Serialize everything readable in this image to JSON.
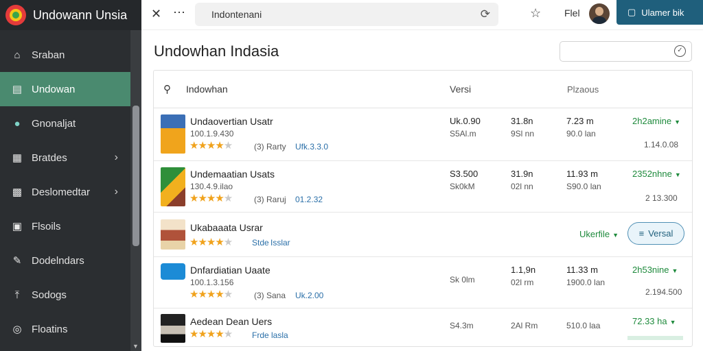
{
  "app": {
    "title": "Undowann Unsia"
  },
  "sidebar": {
    "items": [
      {
        "label": "Sraban",
        "icon": "home-icon"
      },
      {
        "label": "Undowan",
        "icon": "list-icon",
        "active": true
      },
      {
        "label": "Gnonaljat",
        "icon": "chat-icon"
      },
      {
        "label": "Bratdes",
        "icon": "grid-icon",
        "chevron": true
      },
      {
        "label": "Deslomedtar",
        "icon": "table-icon",
        "chevron": true
      },
      {
        "label": "Flsoils",
        "icon": "image-icon"
      },
      {
        "label": "Dodelndars",
        "icon": "pen-icon"
      },
      {
        "label": "Sodogs",
        "icon": "upload-icon"
      },
      {
        "label": "Floatins",
        "icon": "globe-icon"
      }
    ]
  },
  "topbar": {
    "search_value": "Indontenani",
    "file_label": "Flel",
    "button_label": "Ulamer bik"
  },
  "page": {
    "title": "Undowhan Indasia"
  },
  "table": {
    "headers": {
      "name": "Indowhan",
      "version": "Versi",
      "pla": "Plzaous"
    },
    "rows": [
      {
        "title": "Undaovertian Usatr",
        "sub": "100.1.9.430",
        "rating": 4,
        "meta_a": "(3) Rarty",
        "meta_b": "Ufk.3.3.0",
        "c1a": "Uk.0.90",
        "c1b": "S5Al.m",
        "c2a": "31.8n",
        "c2b": "9Sl nn",
        "c3a": "7.23 m",
        "c3b": "90.0 lan",
        "status": "2h2amine",
        "extra": "1.14.0.08"
      },
      {
        "title": "Undemaatian Usats",
        "sub": "130.4.9.ilao",
        "rating": 4,
        "meta_a": "(3) Raruj",
        "meta_b": "01.2.32",
        "c1a": "S3.500",
        "c1b": "Sk0kM",
        "c2a": "31.9n",
        "c2b": "02l nn",
        "c3a": "11.93 m",
        "c3b": "S90.0 lan",
        "status": "2352nhne",
        "extra": "2 13.300"
      },
      {
        "title": "Ukabaaata Usrar",
        "sub": "",
        "rating": 4,
        "meta_a": "Stde",
        "meta_b": "Isslar",
        "status": "Ukerfile",
        "button": "Versal"
      },
      {
        "title": "Dnfardiatian Uaate",
        "sub": "100.1.3.156",
        "rating": 4,
        "meta_a": "(3) Sana",
        "meta_b": "Uk.2.00",
        "c1a": "",
        "c1b": "Sk 0lm",
        "c2a": "1.1,9n",
        "c2b": "02l rm",
        "c3a": "11.33 m",
        "c3b": "1900.0 lan",
        "status": "2h53nine",
        "extra": "2.194.500"
      },
      {
        "title": "Aedean Dean Uers",
        "sub": "",
        "rating": 4,
        "meta_a": "Frde",
        "meta_b": "lasla",
        "c1a": "",
        "c1b": "S4.3m",
        "c2a": "",
        "c2b": "2Al Rm",
        "c3a": "",
        "c3b": "510.0 laa",
        "status": "72.33 ha"
      }
    ]
  },
  "colors": {
    "sidebar_bg": "#2b2e31",
    "sidebar_active": "#4a8a6f",
    "accent_button": "#1f5f7c",
    "status_green": "#1e8a3c",
    "star": "#f0a21c"
  }
}
